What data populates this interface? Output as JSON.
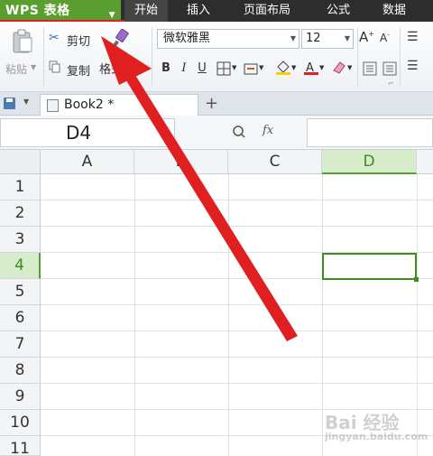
{
  "app": {
    "brand": "WPS 表格"
  },
  "menu": {
    "tabs": [
      {
        "label": "开始"
      },
      {
        "label": "插入"
      },
      {
        "label": "页面布局"
      },
      {
        "label": "公式"
      },
      {
        "label": "数据"
      }
    ]
  },
  "ribbon": {
    "paste_label": "粘贴",
    "cut_label": "剪切",
    "copy_label": "复制",
    "format_painter_label": "格式刷",
    "font_name": "微软雅黑",
    "font_size": "12",
    "bold": "B",
    "italic": "I",
    "underline": "U"
  },
  "tabbar": {
    "document_tab": "Book2 *"
  },
  "formula_bar": {
    "name_box": "D4",
    "fx": "fx"
  },
  "grid": {
    "columns": [
      "A",
      "B",
      "C",
      "D"
    ],
    "rows": [
      "1",
      "2",
      "3",
      "4",
      "5",
      "6",
      "7",
      "8",
      "9",
      "10",
      "11"
    ],
    "selected_cell": "D4"
  },
  "colors": {
    "brand": "#5a9e2f",
    "selection": "#3f8d1f",
    "annotation_red": "#e02020"
  },
  "watermark": {
    "text": "Bai 经验",
    "sub": "jingyan.baidu.com"
  }
}
